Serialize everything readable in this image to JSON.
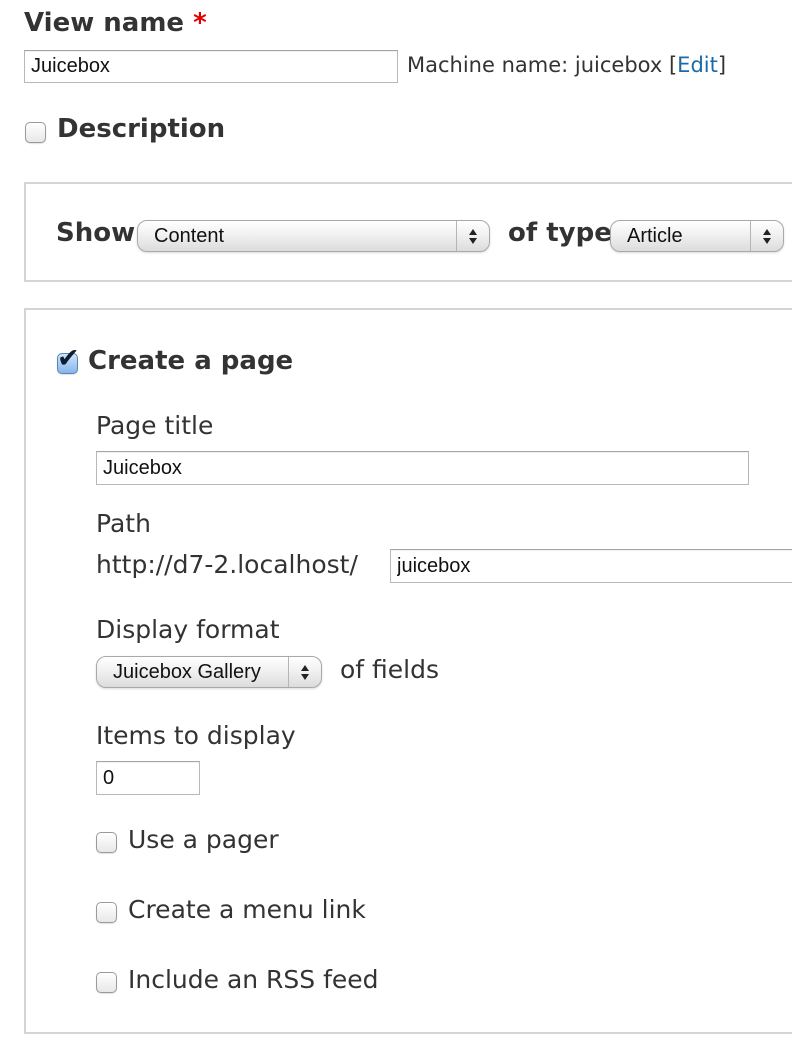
{
  "view_name": {
    "label": "View name",
    "required_marker": "*",
    "value": "Juicebox",
    "machine_name_prefix": "Machine name: juicebox [",
    "machine_name_edit": "Edit",
    "machine_name_suffix": "]"
  },
  "description": {
    "label": "Description",
    "checked": false
  },
  "show": {
    "label": "Show",
    "content_select": "Content",
    "of_type_label": "of type",
    "type_select": "Article"
  },
  "page": {
    "create_label": "Create a page",
    "checked": true,
    "page_title_label": "Page title",
    "page_title_value": "Juicebox",
    "path_label": "Path",
    "path_prefix": "http://d7-2.localhost/",
    "path_value": "juicebox",
    "display_format_label": "Display format",
    "display_format_select": "Juicebox Gallery",
    "of_fields_label": "of fields",
    "items_label": "Items to display",
    "items_value": "0",
    "use_pager_label": "Use a pager",
    "menu_link_label": "Create a menu link",
    "rss_feed_label": "Include an RSS feed"
  },
  "colors": {
    "required": "#e00000",
    "link": "#1a6aaa",
    "check_fill": "#86b6ea"
  }
}
